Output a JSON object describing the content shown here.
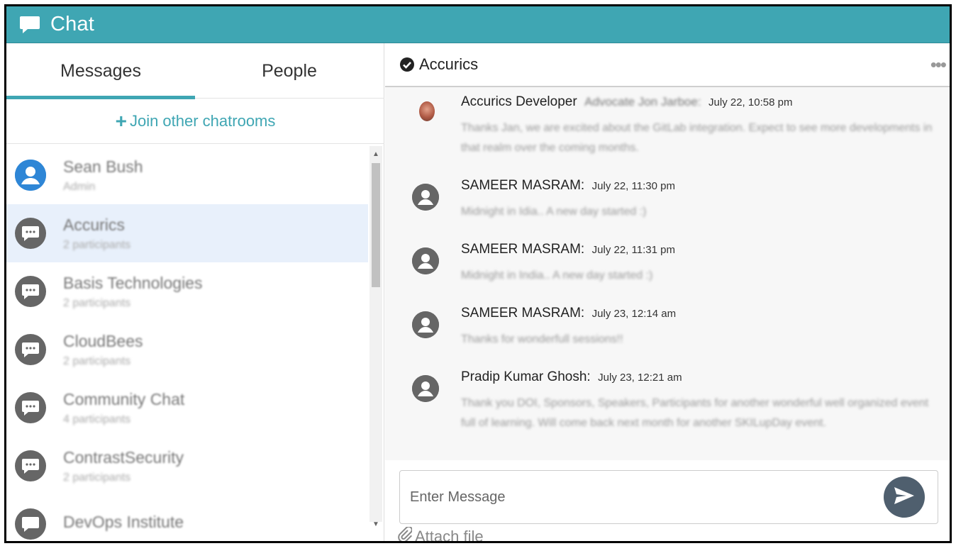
{
  "window": {
    "title": "Chat"
  },
  "tabs": [
    {
      "label": "Messages",
      "active": true
    },
    {
      "label": "People",
      "active": false
    }
  ],
  "join": {
    "label": "Join other chatrooms",
    "plus": "+"
  },
  "rooms": [
    {
      "name": "Sean Bush",
      "sub": "Admin",
      "type": "user"
    },
    {
      "name": "Accurics",
      "sub": "2 participants",
      "type": "room",
      "selected": true
    },
    {
      "name": "Basis Technologies",
      "sub": "2 participants",
      "type": "room"
    },
    {
      "name": "CloudBees",
      "sub": "2 participants",
      "type": "room"
    },
    {
      "name": "Community Chat",
      "sub": "4 participants",
      "type": "room"
    },
    {
      "name": "ContrastSecurity",
      "sub": "2 participants",
      "type": "room"
    },
    {
      "name": "DevOps Institute",
      "sub": "",
      "type": "room"
    }
  ],
  "room_header": {
    "name": "Accurics",
    "more": "•••"
  },
  "messages": [
    {
      "author": "Accurics Developer",
      "mention": "Advocate Jon Jarboe:",
      "time": "July 22, 10:58 pm",
      "body": "Thanks Jan, we are excited about the GitLab integration. Expect to see more developments in that realm over the coming months.",
      "photo": true
    },
    {
      "author": "SAMEER MASRAM:",
      "mention": "",
      "time": "July 22, 11:30 pm",
      "body": "Midnight in Idia.. A new day started :)",
      "photo": false
    },
    {
      "author": "SAMEER MASRAM:",
      "mention": "",
      "time": "July 22, 11:31 pm",
      "body": "Midnight in India.. A new day started :)",
      "photo": false
    },
    {
      "author": "SAMEER MASRAM:",
      "mention": "",
      "time": "July 23, 12:14 am",
      "body": "Thanks for wonderfull sessions!!",
      "photo": false
    },
    {
      "author": "Pradip Kumar Ghosh:",
      "mention": "",
      "time": "July 23, 12:21 am",
      "body": "Thank you DOI, Sponsors, Speakers, Participants for another wonderful well organized event full of learning. Will come back next month for another SKILupDay event.",
      "photo": false
    }
  ],
  "composer": {
    "placeholder": "Enter Message",
    "attach_label": "Attach file"
  },
  "colors": {
    "accent": "#3fa6b3",
    "send": "#4f5f6e",
    "selected_row": "#e8f0fb"
  },
  "icons": [
    "chat-icon",
    "volume-icon",
    "minimize-icon",
    "check-circle-icon",
    "more-icon",
    "user-avatar-icon",
    "chat-room-icon",
    "send-icon",
    "paperclip-icon"
  ]
}
